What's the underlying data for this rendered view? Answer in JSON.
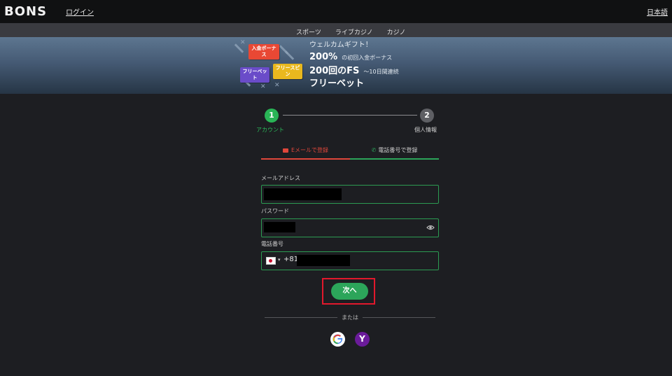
{
  "header": {
    "logo": "BONS",
    "login_link": "ログイン",
    "language": "日本語"
  },
  "nav": {
    "tabs": [
      {
        "label": "スポーツ",
        "underline": "#4aa3f0"
      },
      {
        "label": "ライブカジノ",
        "underline": "#e0473b"
      },
      {
        "label": "カジノ",
        "underline": "#2ca55a"
      }
    ]
  },
  "banner": {
    "tag_deposit": "入金ボーナス",
    "tag_freebet": "フリーベット",
    "tag_freespin": "フリースピン",
    "welcome": "ウェルカムギフト！",
    "bonus_percent": "200%",
    "bonus_desc": "の初回入金ボーナス",
    "fs_count": "200回のFS",
    "fs_desc": "〜10日間連続",
    "freebet": "フリーベット"
  },
  "steps": {
    "step1_number": "1",
    "step1_label": "アカウント",
    "step2_number": "2",
    "step2_label": "個人情報"
  },
  "register_tabs": {
    "email": "Eメールで登録",
    "phone": "電話番号で登録"
  },
  "form": {
    "email_label": "メールアドレス",
    "password_label": "パスワード",
    "phone_label": "電話番号",
    "phone_prefix": "+81"
  },
  "actions": {
    "next": "次へ",
    "or": "または"
  },
  "social": {
    "google": "G",
    "yahoo": "Y"
  },
  "colors": {
    "accent_green": "#2ca55a",
    "accent_red": "#e0473b",
    "highlight": "#e2182c"
  }
}
